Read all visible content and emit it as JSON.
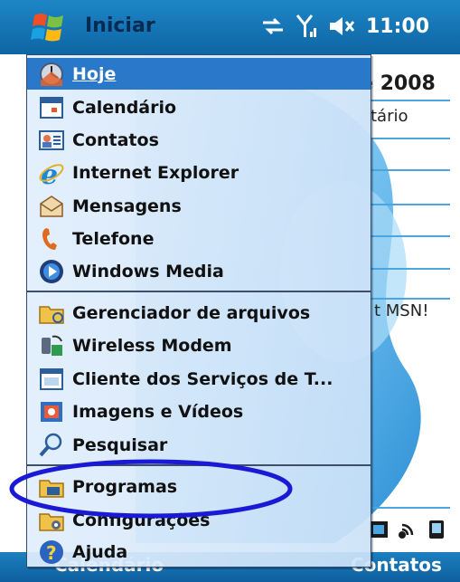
{
  "titlebar": {
    "title": "Iniciar",
    "time": "11:00",
    "icons": [
      "windows-flag-icon",
      "sync-arrows-icon",
      "signal-icon",
      "speaker-muted-icon"
    ]
  },
  "today": {
    "date_fragment": "e 2008",
    "note_fragment": "tário",
    "msn_fragment": "t MSN!",
    "icons": [
      "media-icon",
      "wireless-icon",
      "device-icon"
    ]
  },
  "softkeys": {
    "left": "Calendário",
    "right": "Contatos"
  },
  "menu": {
    "items": [
      {
        "label": "Hoje",
        "icon": "today-icon",
        "selected": true
      },
      {
        "label": "Calendário",
        "icon": "calendar-icon"
      },
      {
        "label": "Contatos",
        "icon": "contacts-icon"
      },
      {
        "label": "Internet Explorer",
        "icon": "internet-explorer-icon"
      },
      {
        "label": "Mensagens",
        "icon": "messages-icon"
      },
      {
        "label": "Telefone",
        "icon": "phone-icon"
      },
      {
        "label": "Windows Media",
        "icon": "windows-media-icon"
      },
      {
        "label": "Gerenciador de arquivos",
        "icon": "file-manager-icon"
      },
      {
        "label": "Wireless Modem",
        "icon": "wireless-modem-icon"
      },
      {
        "label": "Cliente dos Serviços de T...",
        "icon": "terminal-services-icon"
      },
      {
        "label": "Imagens e Vídeos",
        "icon": "pictures-videos-icon"
      },
      {
        "label": "Pesquisar",
        "icon": "search-icon"
      },
      {
        "label": "Programas",
        "icon": "programs-folder-icon"
      },
      {
        "label": "Configurações",
        "icon": "settings-icon"
      },
      {
        "label": "Ajuda",
        "icon": "help-icon"
      }
    ]
  },
  "annotation": {
    "color": "#1a1ad6"
  },
  "colors": {
    "accent": "#2a78c9",
    "titlebar": "#1677b7"
  }
}
